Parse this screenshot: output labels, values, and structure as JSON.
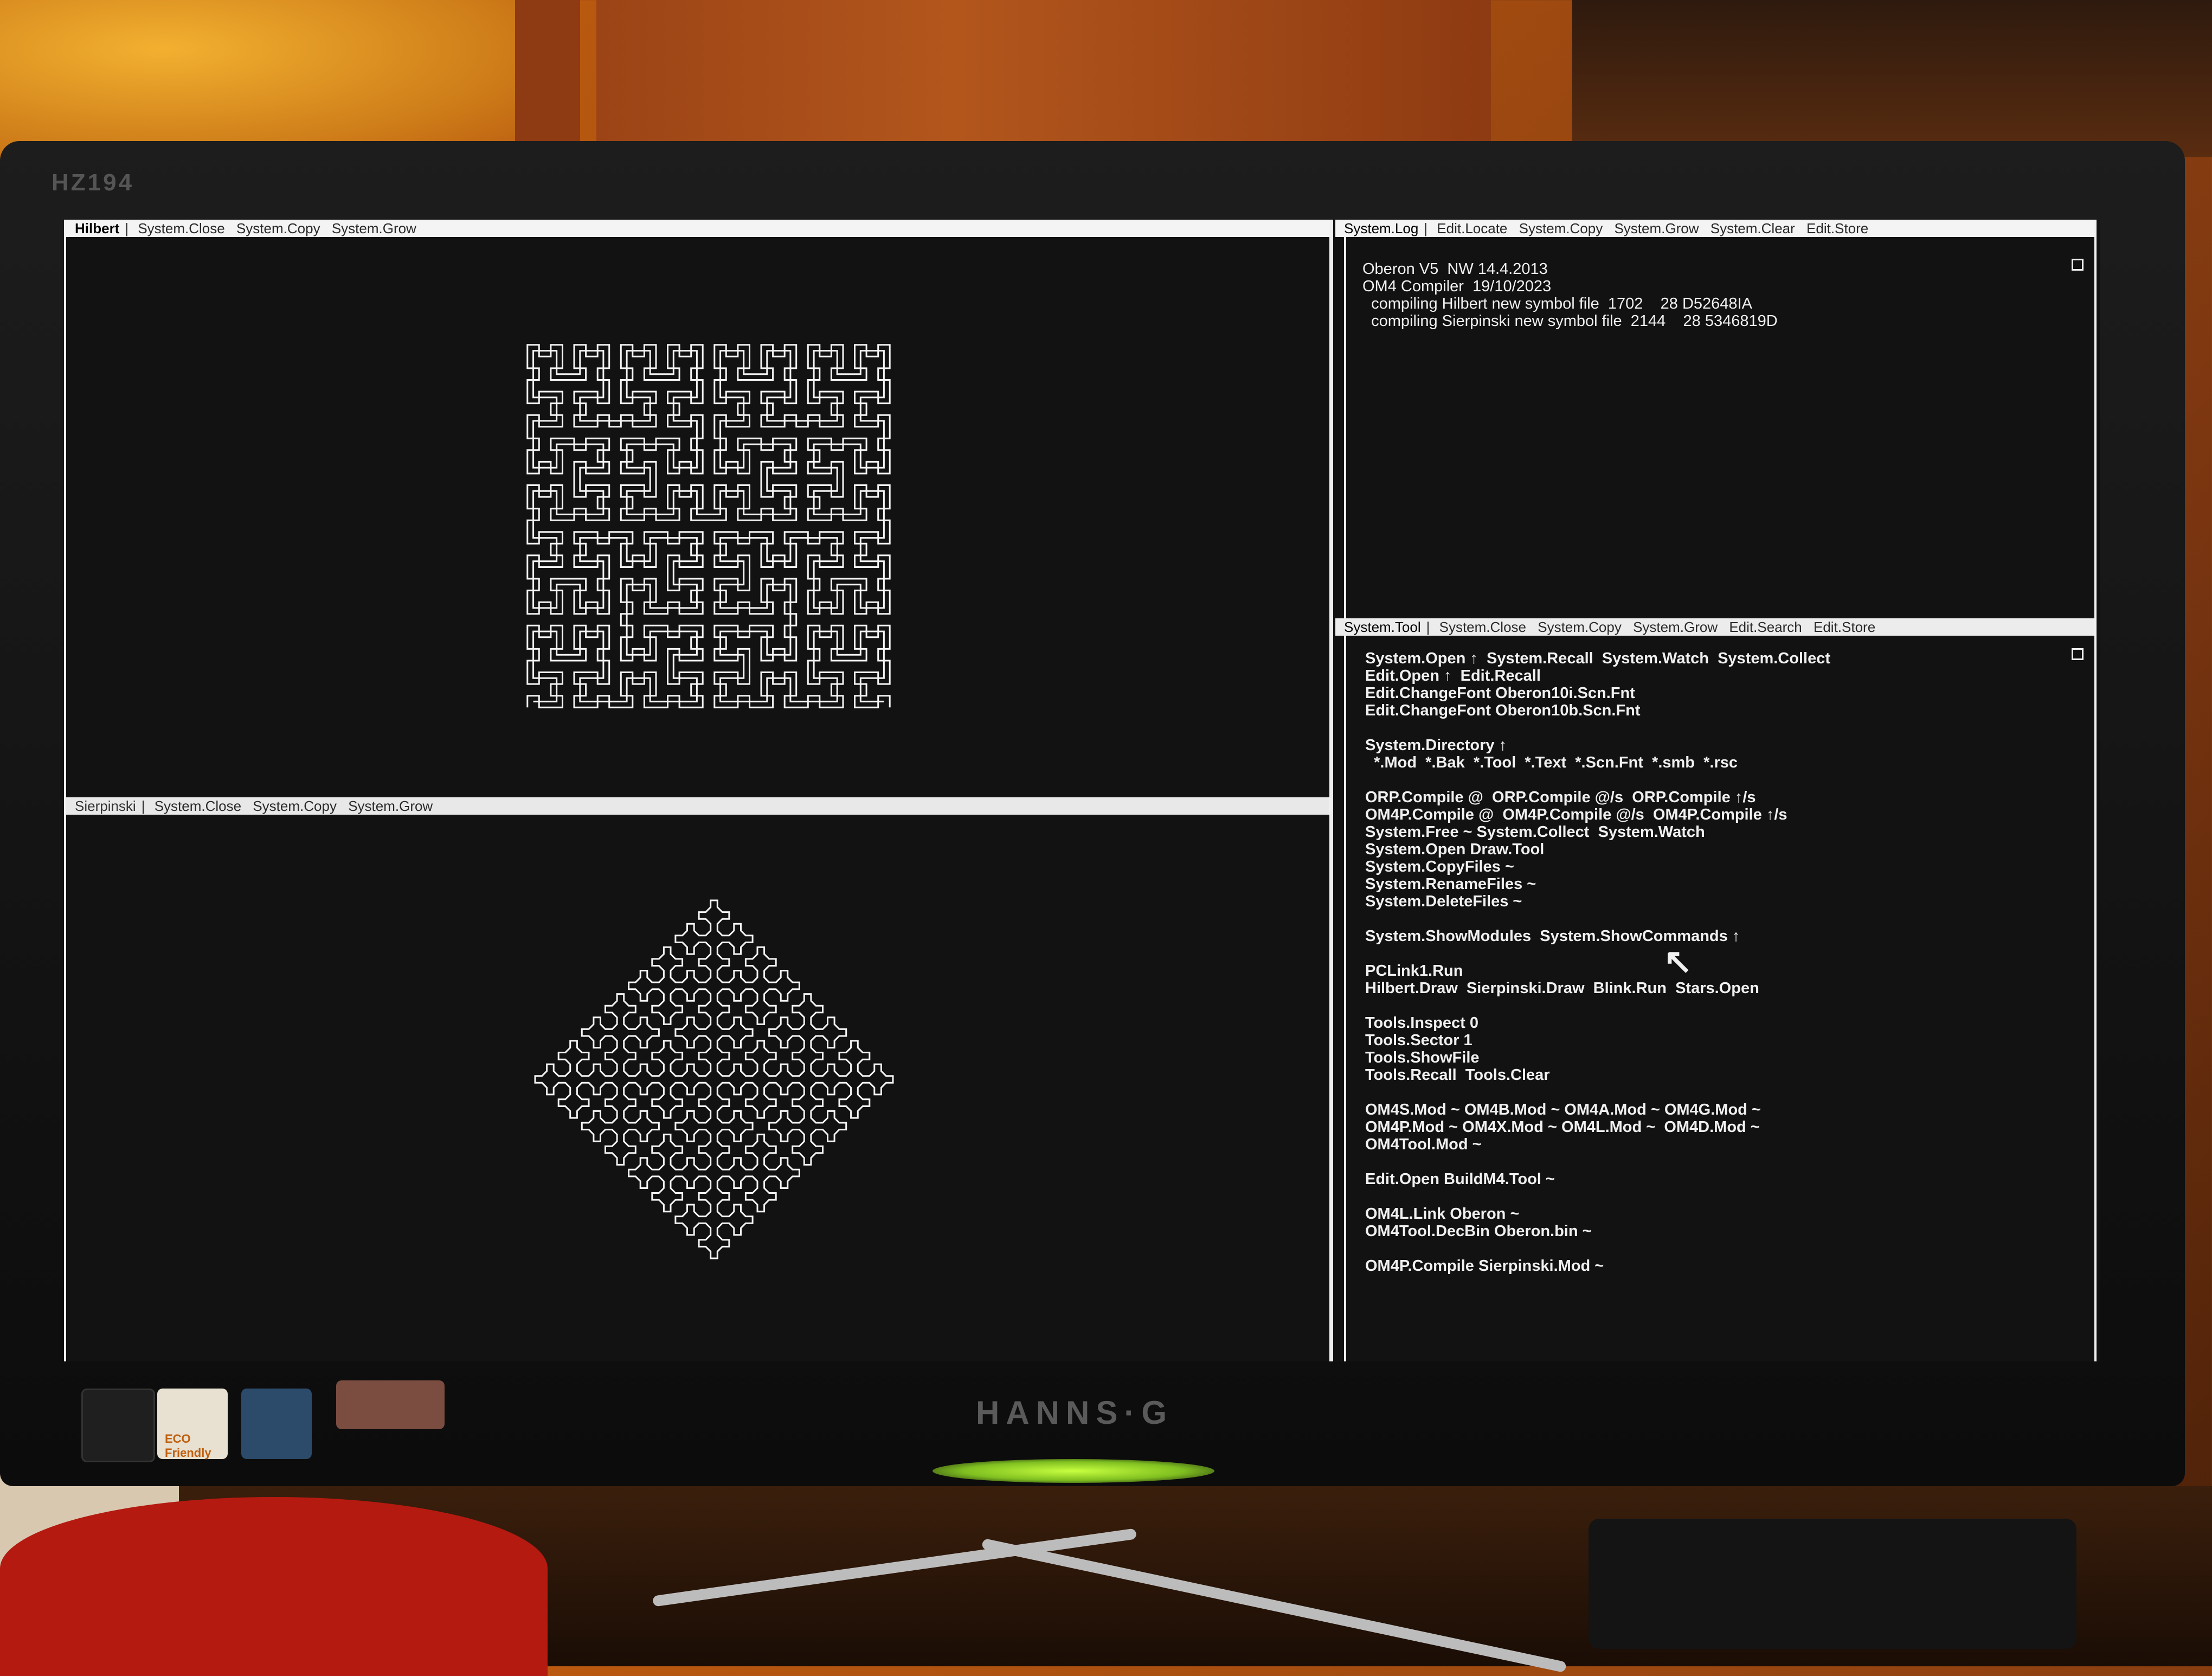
{
  "monitor": {
    "model": "HZ194",
    "brand": "HANNS·G",
    "stickers": [
      "ECO Friendly"
    ]
  },
  "hilbert_viewer": {
    "name": "Hilbert",
    "commands": [
      "System.Close",
      "System.Copy",
      "System.Grow"
    ]
  },
  "sierpinski_viewer": {
    "name": "Sierpinski",
    "commands": [
      "System.Close",
      "System.Copy",
      "System.Grow"
    ]
  },
  "log_viewer": {
    "name": "System.Log",
    "commands": [
      "Edit.Locate",
      "System.Copy",
      "System.Grow",
      "System.Clear",
      "Edit.Store"
    ],
    "lines": [
      "Oberon V5  NW 14.4.2013",
      "OM4 Compiler  19/10/2023",
      "  compiling Hilbert new symbol file  1702    28 D52648IA",
      "  compiling Sierpinski new symbol file  2144    28 5346819D"
    ]
  },
  "tool_viewer": {
    "name": "System.Tool",
    "commands": [
      "System.Close",
      "System.Copy",
      "System.Grow",
      "Edit.Search",
      "Edit.Store"
    ],
    "lines": [
      "System.Open ↑  System.Recall  System.Watch  System.Collect",
      "Edit.Open ↑  Edit.Recall",
      "Edit.ChangeFont Oberon10i.Scn.Fnt",
      "Edit.ChangeFont Oberon10b.Scn.Fnt",
      "",
      "System.Directory ↑",
      "  *.Mod  *.Bak  *.Tool  *.Text  *.Scn.Fnt  *.smb  *.rsc",
      "",
      "ORP.Compile @  ORP.Compile @/s  ORP.Compile ↑/s",
      "OM4P.Compile @  OM4P.Compile @/s  OM4P.Compile ↑/s",
      "System.Free ~ System.Collect  System.Watch",
      "System.Open Draw.Tool",
      "System.CopyFiles ~",
      "System.RenameFiles ~",
      "System.DeleteFiles ~",
      "",
      "System.ShowModules  System.ShowCommands ↑",
      "",
      "PCLink1.Run",
      "Hilbert.Draw  Sierpinski.Draw  Blink.Run  Stars.Open",
      "",
      "Tools.Inspect 0",
      "Tools.Sector 1",
      "Tools.ShowFile",
      "Tools.Recall  Tools.Clear",
      "",
      "OM4S.Mod ~ OM4B.Mod ~ OM4A.Mod ~ OM4G.Mod ~",
      "OM4P.Mod ~ OM4X.Mod ~ OM4L.Mod ~  OM4D.Mod ~",
      "OM4Tool.Mod ~",
      "",
      "Edit.Open BuildM4.Tool ~",
      "",
      "OM4L.Link Oberon ~",
      "OM4Tool.DecBin Oberon.bin ~",
      "",
      "OM4P.Compile Sierpinski.Mod ~"
    ]
  },
  "colors": {
    "screen_bg": "#121212",
    "foreground": "#f0f0f0",
    "titlebar_bg": "#f4f4f4",
    "power_led": "#a8ff30"
  },
  "icons": [
    "mouse-pointer-icon",
    "scroll-marker-icon",
    "hilbert-curve-figure",
    "sierpinski-curve-figure"
  ]
}
